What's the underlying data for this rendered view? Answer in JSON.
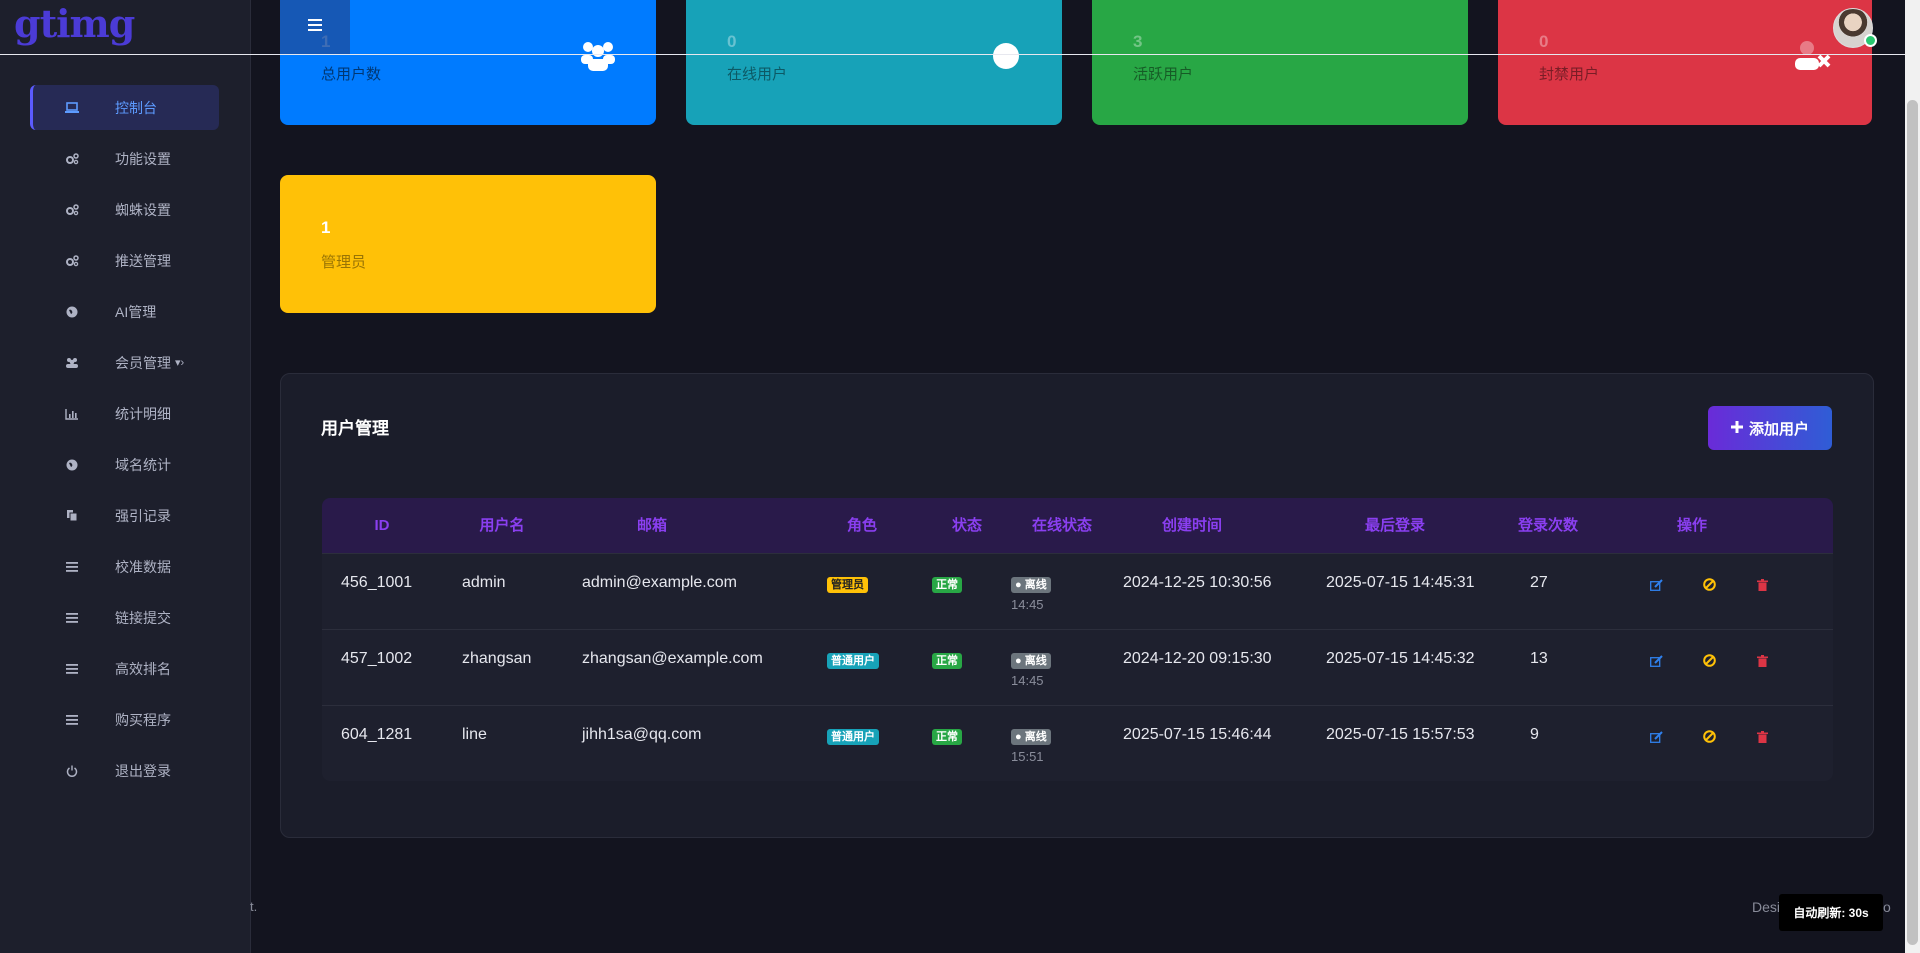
{
  "app": {
    "logo": "gtimg"
  },
  "sidebar": {
    "items": [
      {
        "label": "控制台",
        "icon": "laptop-icon",
        "active": true
      },
      {
        "label": "功能设置",
        "icon": "cogs-icon"
      },
      {
        "label": "蜘蛛设置",
        "icon": "cogs-icon"
      },
      {
        "label": "推送管理",
        "icon": "cogs-icon"
      },
      {
        "label": "AI管理",
        "icon": "globe-icon"
      },
      {
        "label": "会员管理",
        "icon": "users-icon",
        "caret": "▾›"
      },
      {
        "label": "统计明细",
        "icon": "bar-chart-icon"
      },
      {
        "label": "域名统计",
        "icon": "globe-icon"
      },
      {
        "label": "强引记录",
        "icon": "copy-icon"
      },
      {
        "label": "校准数据",
        "icon": "bars-icon"
      },
      {
        "label": "链接提交",
        "icon": "bars-icon"
      },
      {
        "label": "高效排名",
        "icon": "bars-icon"
      },
      {
        "label": "购买程序",
        "icon": "bars-icon"
      },
      {
        "label": "退出登录",
        "icon": "power-icon"
      }
    ]
  },
  "stats": [
    {
      "value": "1",
      "label": "总用户数",
      "color": "#007bff",
      "icon": "users-icon"
    },
    {
      "value": "0",
      "label": "在线用户",
      "color": "#17a2b8",
      "icon": "circle-icon"
    },
    {
      "value": "3",
      "label": "活跃用户",
      "color": "#28a745",
      "icon": "user-check-icon"
    },
    {
      "value": "0",
      "label": "封禁用户",
      "color": "#dc3545",
      "icon": "user-times-icon"
    },
    {
      "value": "1",
      "label": "管理员",
      "color": "#ffc107",
      "icon": ""
    }
  ],
  "users_panel": {
    "title": "用户管理",
    "add_button": "添加用户",
    "columns": [
      "ID",
      "用户名",
      "邮箱",
      "角色",
      "状态",
      "在线状态",
      "创建时间",
      "最后登录",
      "登录次数",
      "操作"
    ],
    "rows": [
      {
        "id": "456_1001",
        "username": "admin",
        "email": "admin@example.com",
        "role": "管理员",
        "role_type": "admin",
        "status": "正常",
        "online": "● 离线",
        "online_time": "14:45",
        "created": "2024-12-25 10:30:56",
        "last_login": "2025-07-15 14:45:31",
        "logins": "27"
      },
      {
        "id": "457_1002",
        "username": "zhangsan",
        "email": "zhangsan@example.com",
        "role": "普通用户",
        "role_type": "user",
        "status": "正常",
        "online": "● 离线",
        "online_time": "14:45",
        "created": "2024-12-20 09:15:30",
        "last_login": "2025-07-15 14:45:32",
        "logins": "13"
      },
      {
        "id": "604_1281",
        "username": "line",
        "email": "jihh1sa@qq.com",
        "role": "普通用户",
        "role_type": "user",
        "status": "正常",
        "online": "● 离线",
        "online_time": "15:51",
        "created": "2025-07-15 15:46:44",
        "last_login": "2025-07-15 15:57:53",
        "logins": "9"
      }
    ]
  },
  "footer": {
    "left": "t.",
    "right": "Desi",
    "right_tail": "o",
    "auto_refresh": "自动刷新: 30s"
  }
}
